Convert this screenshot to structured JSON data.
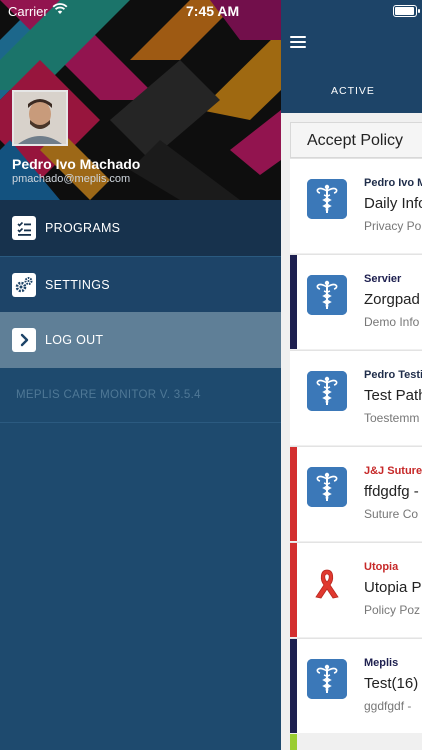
{
  "status_bar": {
    "carrier": "Carrier",
    "time": "7:45 AM"
  },
  "drawer": {
    "user": {
      "name": "Pedro Ivo Machado",
      "email": "pmachado@meplis.com"
    },
    "menu": [
      {
        "label": "PROGRAMS",
        "icon": "checklist-icon"
      },
      {
        "label": "SETTINGS",
        "icon": "gears-icon"
      },
      {
        "label": "LOG OUT",
        "icon": "chevron-right-icon"
      }
    ],
    "version": "MEPLIS CARE MONITOR V. 3.5.4"
  },
  "main": {
    "tab": "ACTIVE",
    "section_title": "Accept Policy",
    "cards": [
      {
        "org": "Pedro Ivo M",
        "title": "Daily Info",
        "subtitle": "Privacy Po",
        "stripe": "",
        "org_color": "#1f2d4a",
        "icon": "caduceus-icon"
      },
      {
        "org": "Servier",
        "title": "Zorgpad",
        "subtitle": "Demo Info",
        "stripe": "#1d1f4f",
        "org_color": "#1d1f4f",
        "icon": "caduceus-icon"
      },
      {
        "org": "Pedro Testi",
        "title": "Test Path",
        "subtitle": "Toestemm",
        "stripe": "",
        "org_color": "#1f2d4a",
        "icon": "caduceus-icon"
      },
      {
        "org": "J&J Suture",
        "title": "ffdgdfg -",
        "subtitle": "Suture Co",
        "stripe": "#d32f2f",
        "org_color": "#c62828",
        "icon": "caduceus-icon"
      },
      {
        "org": "Utopia",
        "title": "Utopia P",
        "subtitle": "Policy Poz",
        "stripe": "#d32f2f",
        "org_color": "#c62828",
        "icon": "awareness-ribbon-icon"
      },
      {
        "org": "Meplis",
        "title": "Test(16)",
        "subtitle": "ggdfgdf -",
        "stripe": "#1d1f4f",
        "org_color": "#1d1f4f",
        "icon": "caduceus-icon"
      }
    ]
  }
}
